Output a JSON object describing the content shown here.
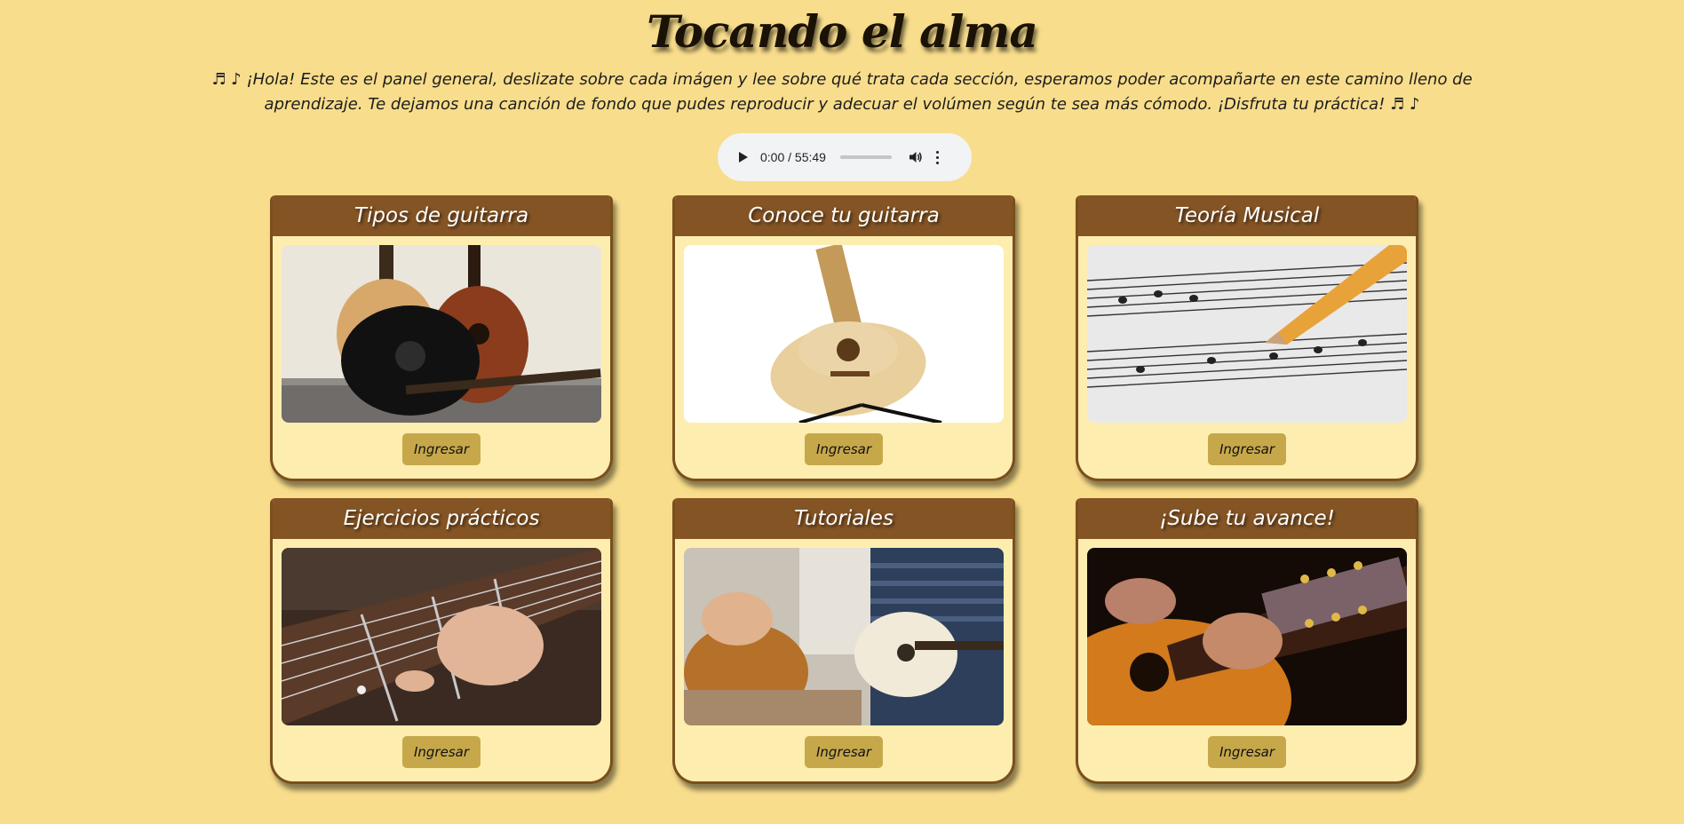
{
  "header": {
    "title": "Tocando el alma",
    "intro": "♬ ♪ ¡Hola! Este es el panel general, deslizate sobre cada imágen y lee sobre qué trata cada sección, esperamos poder acompañarte en este camino lleno de aprendizaje. Te dejamos una canción de fondo que pudes reproducir y adecuar el volúmen según te sea más cómodo. ¡Disfruta tu práctica! ♬ ♪"
  },
  "audio_player": {
    "time": "0:00 / 55:49",
    "progress": 0,
    "play_icon": "play-icon",
    "volume_icon": "volume-icon",
    "menu_icon": "more-vert-icon"
  },
  "colors": {
    "background": "#f8dd8c",
    "card_header": "#845424",
    "card_body": "#fdeeb0",
    "button": "#c6a84b"
  },
  "cards": [
    {
      "title": "Tipos de guitarra",
      "button": "Ingresar",
      "image": "acoustic-guitars-photo"
    },
    {
      "title": "Conoce tu guitarra",
      "button": "Ingresar",
      "image": "classical-guitar-photo"
    },
    {
      "title": "Teoría Musical",
      "button": "Ingresar",
      "image": "sheet-music-pencil-photo"
    },
    {
      "title": "Ejercicios prácticos",
      "button": "Ingresar",
      "image": "fretboard-hand-photo"
    },
    {
      "title": "Tutoriales",
      "button": "Ingresar",
      "image": "guitar-lesson-photo"
    },
    {
      "title": "¡Sube tu avance!",
      "button": "Ingresar",
      "image": "playing-guitar-photo"
    }
  ]
}
